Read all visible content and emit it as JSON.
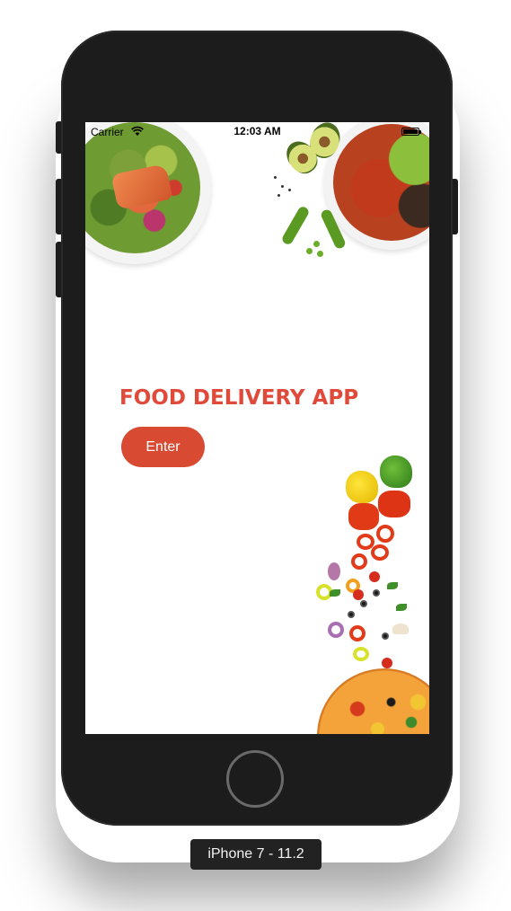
{
  "status_bar": {
    "carrier": "Carrier",
    "time": "12:03 AM"
  },
  "app": {
    "title": "FOOD DELIVERY APP",
    "enter_label": "Enter",
    "accent_color": "#e04a3a",
    "button_color": "#d84a32"
  },
  "device": {
    "label": "iPhone 7 - 11.2"
  },
  "icons": [
    "wifi-icon",
    "battery-icon"
  ]
}
